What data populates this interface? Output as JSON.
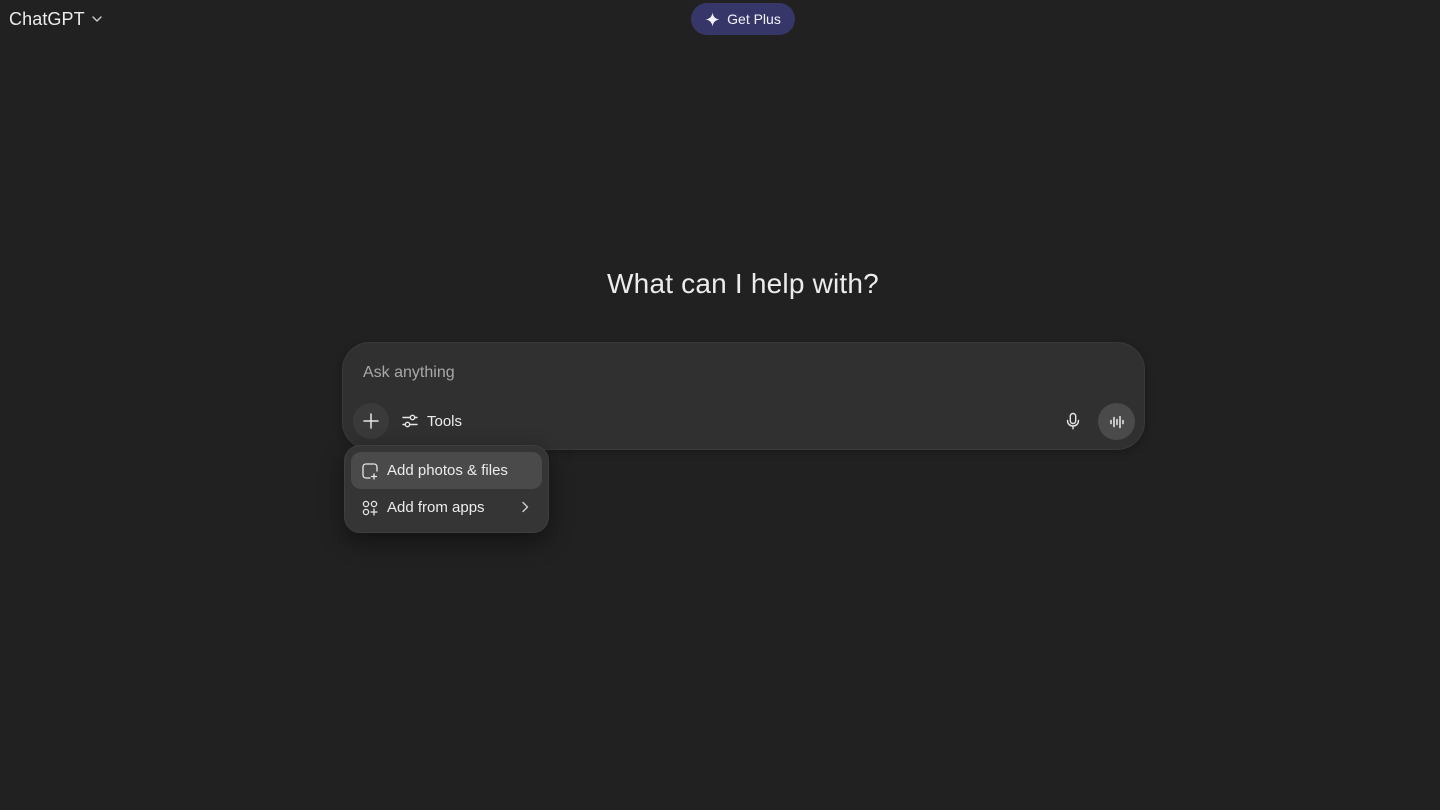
{
  "header": {
    "model_name": "ChatGPT",
    "model_icon": "chevron-down-icon",
    "upgrade_label": "Get Plus",
    "upgrade_icon": "sparkle-icon",
    "upgrade_color": "#373669"
  },
  "hero": {
    "title": "What can I help with?"
  },
  "composer": {
    "placeholder": "Ask anything",
    "value": "",
    "add_icon": "plus-icon",
    "tools_label": "Tools",
    "tools_icon": "sliders-icon",
    "mic_icon": "microphone-icon",
    "voice_icon": "voice-waveform-icon"
  },
  "attach_menu": {
    "items": [
      {
        "label": "Add photos & files",
        "icon": "paperclip-file-icon",
        "highlighted": true
      },
      {
        "label": "Add from apps",
        "icon": "apps-grid-icon",
        "has_submenu": true,
        "submenu_icon": "chevron-right-icon"
      }
    ]
  },
  "colors": {
    "background": "#212121",
    "composer": "#303030",
    "menu": "#353535",
    "text": "#ececec",
    "placeholder": "#a8a8a8"
  }
}
